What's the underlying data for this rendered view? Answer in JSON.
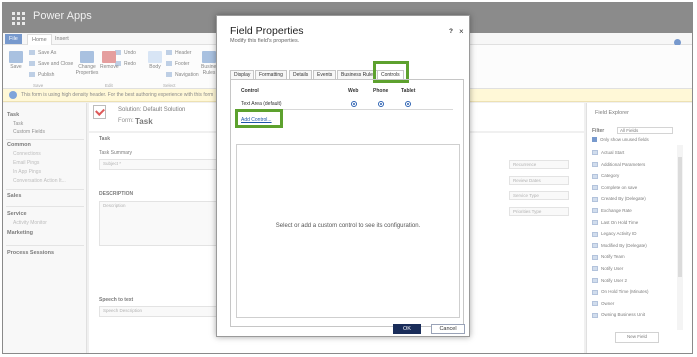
{
  "app": {
    "title": "Power Apps"
  },
  "ribbon": {
    "tabs": [
      "File",
      "Home",
      "Insert"
    ],
    "save": "Save",
    "save_as": "Save As",
    "save_and_close": "Save and Close",
    "publish": "Publish",
    "undo": "Undo",
    "redo": "Redo",
    "change_properties": "Change Properties",
    "remove": "Remove",
    "body": "Body",
    "header": "Header",
    "footer": "Footer",
    "navigation": "Navigation",
    "business_rules": "Business Rules",
    "group_save": "Save",
    "group_edit": "Edit",
    "group_select": "Select"
  },
  "banner": {
    "text": "This form is using high density header. For the best authoring experience with this form"
  },
  "leftnav": {
    "task": {
      "title": "Task",
      "items": [
        "Task",
        "Custom Fields"
      ]
    },
    "common": {
      "title": "Common",
      "items": [
        "Connections",
        "Email Pings",
        "In App Pings",
        "Conversation Action It..."
      ]
    },
    "sales": {
      "title": "Sales"
    },
    "service": {
      "title": "Service",
      "items": [
        "Activity Monitor"
      ]
    },
    "marketing": {
      "title": "Marketing"
    },
    "process": {
      "title": "Process Sessions"
    }
  },
  "form": {
    "solution": "Solution: Default Solution",
    "form_label": "Form:",
    "form_name": "Task",
    "section_task": "Task",
    "task_summary": "Task Summary",
    "subject": "Subject",
    "description_hdr": "DESCRIPTION",
    "description": "Description",
    "speech": "Speech to text",
    "speech_field": "Speech Description",
    "right_fields": [
      "Recurrence",
      "Review Dates",
      "Service Type",
      "Priorities Type"
    ]
  },
  "explorer": {
    "title": "Field Explorer",
    "filter_label": "Filter",
    "filter_value": "All Fields",
    "only_unused": "Only show unused fields",
    "fields": [
      "Actual Start",
      "Additional Parameters",
      "Category",
      "Complete on save",
      "Created By (Delegate)",
      "Exchange Rate",
      "Last On Hold Time",
      "Legacy Activity ID",
      "Modified By (Delegate)",
      "Notify Team",
      "Notify User",
      "Notify User 2",
      "On Hold Time (Minutes)",
      "Owner",
      "Owning Business Unit"
    ],
    "new_field": "New Field"
  },
  "dialog": {
    "title": "Field Properties",
    "subtitle": "Modify this field's properties.",
    "help": "?",
    "close": "×",
    "tabs": [
      "Display",
      "Formatting",
      "Details",
      "Events",
      "Business Rules",
      "Controls"
    ],
    "active_tab": "Controls",
    "columns": {
      "control": "Control",
      "web": "Web",
      "phone": "Phone",
      "tablet": "Tablet"
    },
    "control_row": "Text Area (default)",
    "add_control": "Add Control...",
    "placeholder": "Select or add a custom control to see its configuration.",
    "ok": "OK",
    "cancel": "Cancel"
  },
  "colors": {
    "highlight": "#5da12e",
    "brand": "#2e63b3",
    "ok_button": "#1a2d5a"
  }
}
